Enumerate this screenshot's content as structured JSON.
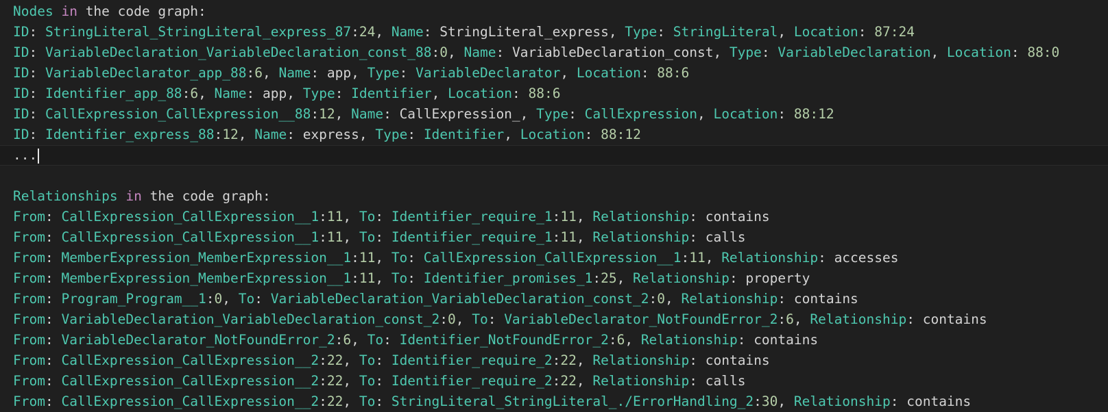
{
  "nodes_section": {
    "header": {
      "w1": "Nodes",
      "kw": "in",
      "rest": "the code graph:"
    },
    "rows": [
      {
        "id": "StringLiteral_StringLiteral_express_87",
        "id_num": "24",
        "name": "StringLiteral_express",
        "type": "StringLiteral",
        "loc": "87:24"
      },
      {
        "id": "VariableDeclaration_VariableDeclaration_const_88",
        "id_num": "0",
        "name": "VariableDeclaration_const",
        "type": "VariableDeclaration",
        "loc": "88:0"
      },
      {
        "id": "VariableDeclarator_app_88",
        "id_num": "6",
        "name": "app",
        "type": "VariableDeclarator",
        "loc": "88:6"
      },
      {
        "id": "Identifier_app_88",
        "id_num": "6",
        "name": "app",
        "type": "Identifier",
        "loc": "88:6"
      },
      {
        "id": "CallExpression_CallExpression__88",
        "id_num": "12",
        "name": "CallExpression_",
        "type": "CallExpression",
        "loc": "88:12"
      },
      {
        "id": "Identifier_express_88",
        "id_num": "12",
        "name": "express",
        "type": "Identifier",
        "loc": "88:12"
      }
    ],
    "ellipsis": "..."
  },
  "relationships_section": {
    "header": {
      "w1": "Relationships",
      "kw": "in",
      "rest": "the code graph:"
    },
    "rows": [
      {
        "from": "CallExpression_CallExpression__1",
        "from_num": "11",
        "to": "Identifier_require_1",
        "to_num": "11",
        "rel": "contains"
      },
      {
        "from": "CallExpression_CallExpression__1",
        "from_num": "11",
        "to": "Identifier_require_1",
        "to_num": "11",
        "rel": "calls"
      },
      {
        "from": "MemberExpression_MemberExpression__1",
        "from_num": "11",
        "to": "CallExpression_CallExpression__1",
        "to_num": "11",
        "rel": "accesses"
      },
      {
        "from": "MemberExpression_MemberExpression__1",
        "from_num": "11",
        "to": "Identifier_promises_1",
        "to_num": "25",
        "rel": "property"
      },
      {
        "from": "Program_Program__1",
        "from_num": "0",
        "to": "VariableDeclaration_VariableDeclaration_const_2",
        "to_num": "0",
        "rel": "contains"
      },
      {
        "from": "VariableDeclaration_VariableDeclaration_const_2",
        "from_num": "0",
        "to": "VariableDeclarator_NotFoundError_2",
        "to_num": "6",
        "rel": "contains"
      },
      {
        "from": "VariableDeclarator_NotFoundError_2",
        "from_num": "6",
        "to": "Identifier_NotFoundError_2",
        "to_num": "6",
        "rel": "contains"
      },
      {
        "from": "CallExpression_CallExpression__2",
        "from_num": "22",
        "to": "Identifier_require_2",
        "to_num": "22",
        "rel": "contains"
      },
      {
        "from": "CallExpression_CallExpression__2",
        "from_num": "22",
        "to": "Identifier_require_2",
        "to_num": "22",
        "rel": "calls"
      },
      {
        "from": "CallExpression_CallExpression__2",
        "from_num": "22",
        "to": "StringLiteral_StringLiteral_./ErrorHandling_2",
        "to_num": "30",
        "rel": "contains"
      }
    ]
  },
  "labels": {
    "id": "ID",
    "name": "Name",
    "type": "Type",
    "location": "Location",
    "from": "From",
    "to": "To",
    "relationship": "Relationship"
  },
  "colors": {
    "background": "#1f1f1f",
    "key_teal": "#4ec9b0",
    "plain": "#d4d4d4",
    "number": "#b5cea8",
    "keyword": "#c586c0"
  }
}
